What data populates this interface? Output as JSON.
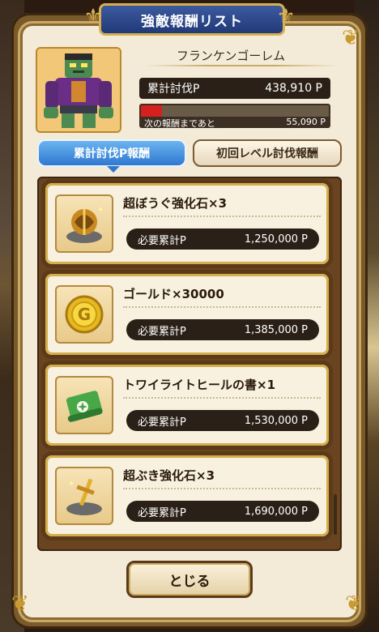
{
  "dialog": {
    "title": "強敵報酬リスト"
  },
  "monster": {
    "name": "フランケンゴーレム",
    "total_label": "累計討伐P",
    "total_value": "438,910 P",
    "next_label": "次の報酬まであと",
    "next_value": "55,090 P",
    "progress_fraction": 0.11
  },
  "tabs": [
    {
      "label": "累計討伐P報酬",
      "active": true
    },
    {
      "label": "初回レベル討伐報酬",
      "active": false
    }
  ],
  "rewards": [
    {
      "name": "超ぼうぐ強化石×3",
      "req_label": "必要累計P",
      "req_value": "1,250,000 P",
      "icon": "armor-stone-icon"
    },
    {
      "name": "ゴールド×30000",
      "req_label": "必要累計P",
      "req_value": "1,385,000 P",
      "icon": "gold-coin-icon"
    },
    {
      "name": "トワイライトヒールの書×1",
      "req_label": "必要累計P",
      "req_value": "1,530,000 P",
      "icon": "scroll-icon"
    },
    {
      "name": "超ぶき強化石×3",
      "req_label": "必要累計P",
      "req_value": "1,690,000 P",
      "icon": "weapon-stone-icon"
    }
  ],
  "close_button": {
    "label": "とじる"
  }
}
